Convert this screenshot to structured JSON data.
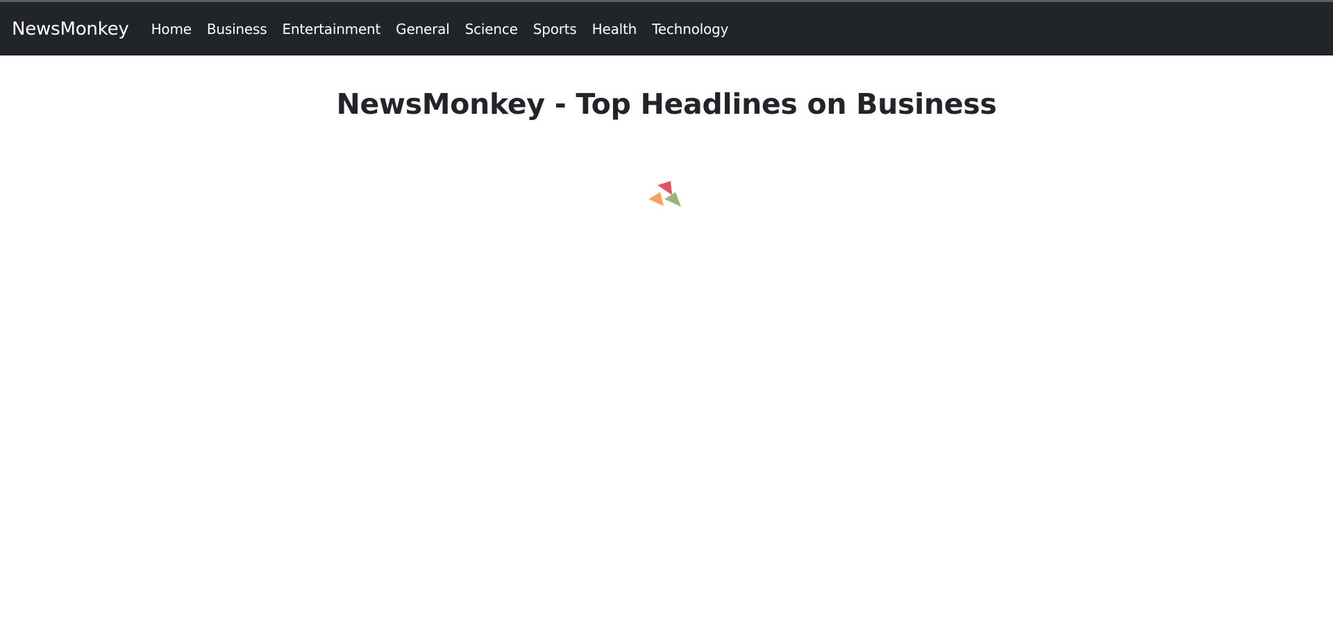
{
  "navbar": {
    "brand": "NewsMonkey",
    "items": [
      {
        "label": "Home"
      },
      {
        "label": "Business"
      },
      {
        "label": "Entertainment"
      },
      {
        "label": "General"
      },
      {
        "label": "Science"
      },
      {
        "label": "Sports"
      },
      {
        "label": "Health"
      },
      {
        "label": "Technology"
      }
    ]
  },
  "main": {
    "title": "NewsMonkey - Top Headlines on Business",
    "spinner": {
      "icon": "loading-spinner-icon",
      "colors": [
        "#e05263",
        "#f5a35c",
        "#9cb27a"
      ]
    }
  },
  "colors": {
    "navbar_bg": "#212529",
    "text_dark": "#212529"
  }
}
